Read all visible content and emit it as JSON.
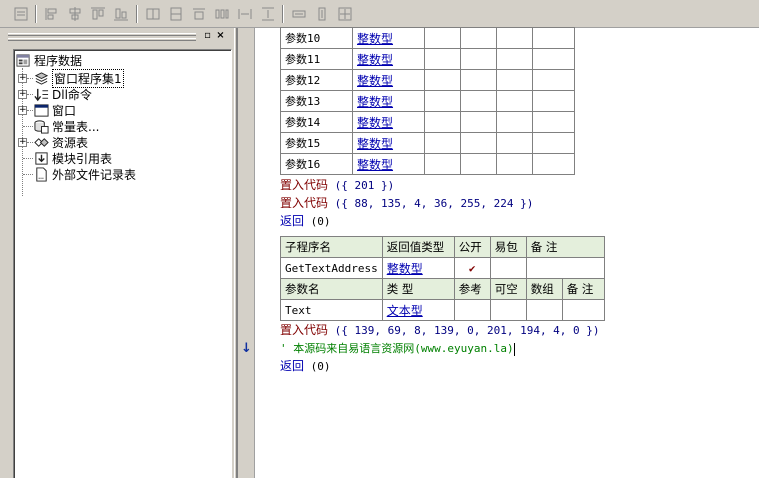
{
  "tree": {
    "root": "程序数据",
    "items": [
      {
        "label": "窗口程序集1",
        "icon": "assembly-icon",
        "expandable": true
      },
      {
        "label": "Dll命令",
        "icon": "dll-icon",
        "expandable": true
      },
      {
        "label": "窗口",
        "icon": "window-icon",
        "expandable": true
      },
      {
        "label": "常量表...",
        "icon": "constant-table-icon",
        "expandable": false
      },
      {
        "label": "资源表",
        "icon": "resource-table-icon",
        "expandable": true
      },
      {
        "label": "模块引用表",
        "icon": "module-reference-icon",
        "expandable": false
      },
      {
        "label": "外部文件记录表",
        "icon": "external-file-icon",
        "expandable": false
      }
    ]
  },
  "params_top": [
    {
      "name": "参数10",
      "type": "整数型"
    },
    {
      "name": "参数11",
      "type": "整数型"
    },
    {
      "name": "参数12",
      "type": "整数型"
    },
    {
      "name": "参数13",
      "type": "整数型"
    },
    {
      "name": "参数14",
      "type": "整数型"
    },
    {
      "name": "参数15",
      "type": "整数型"
    },
    {
      "name": "参数16",
      "type": "整数型"
    }
  ],
  "code_lines_1": [
    {
      "kw": "置入代码",
      "args": "({ 201 })"
    },
    {
      "kw": "置入代码",
      "args": "({ 88, 135, 4, 36, 255, 224 })"
    }
  ],
  "return_1": {
    "kw": "返回",
    "args": "(0)"
  },
  "sub_table": {
    "headers": [
      "子程序名",
      "返回值类型",
      "公开",
      "易包",
      "备 注"
    ],
    "row": {
      "name": "GetTextAddress",
      "return_type": "整数型",
      "public_mark": "✔"
    },
    "param_headers": [
      "参数名",
      "类 型",
      "参考",
      "可空",
      "数组",
      "备 注"
    ],
    "params": [
      {
        "name": "Text",
        "type": "文本型"
      }
    ]
  },
  "code_lines_2": [
    {
      "kw": "置入代码",
      "args": "({ 139, 69, 8, 139, 0, 201, 194, 4, 0 })"
    }
  ],
  "comment": "' 本源码来自易语言资源网(www.eyuyan.la)",
  "return_2": {
    "kw": "返回",
    "args": "(0)"
  }
}
